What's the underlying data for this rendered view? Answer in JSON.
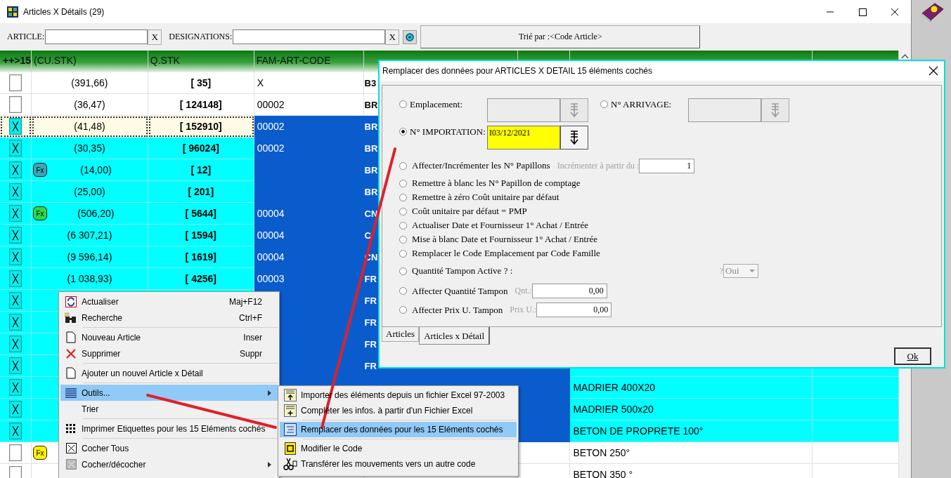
{
  "window": {
    "title": "Articles X Détails (29)"
  },
  "toolbar": {
    "article_label": "ARTICLE:",
    "article_clear": "X",
    "designation_label": "DESIGNATIONS:",
    "designation_clear": "X",
    "sort_button": "Trié par :<Code Article>"
  },
  "table": {
    "columns": [
      {
        "label": "++>15"
      },
      {
        "label": "(CU.STK)"
      },
      {
        "label": "Q.STK"
      },
      {
        "label": "FAM-ART-CODE"
      }
    ],
    "rows": [
      {
        "checked": false,
        "selected": false,
        "cu_stk": "(391,66)",
        "q_stk": "[ 35]",
        "fam_code": "X",
        "article": "B3"
      },
      {
        "checked": false,
        "selected": false,
        "cu_stk": "(36,47)",
        "q_stk": "[ 124148]",
        "fam_code": "00002",
        "article": "BR"
      },
      {
        "checked": true,
        "selected": true,
        "cu_stk": "(41,48)",
        "q_stk": "[ 152910]",
        "fam_code": "00002",
        "article": "BR"
      },
      {
        "checked": true,
        "selected": false,
        "cu_stk": "(30,35)",
        "q_stk": "[ 96024]",
        "fam_code": "00002",
        "article": "BR"
      },
      {
        "checked": true,
        "selected": false,
        "badge": "Fx",
        "color": "#3aa6b4",
        "cu_stk": "(14,00)",
        "q_stk": "[ 12]",
        "article": "BR"
      },
      {
        "checked": true,
        "selected": false,
        "cu_stk": "(25,00)",
        "q_stk": "[ 201]",
        "article": "BR"
      },
      {
        "checked": true,
        "selected": false,
        "badge": "Fx",
        "color": "#2ed84a",
        "cu_stk": "(506,20)",
        "q_stk": "[ 5644]",
        "fam_code": "00004",
        "article": "CN"
      },
      {
        "checked": true,
        "selected": false,
        "cu_stk": "(6 307,21)",
        "q_stk": "[ 1594]",
        "fam_code": "00004",
        "article": "C"
      },
      {
        "checked": true,
        "selected": false,
        "cu_stk": "(9 596,14)",
        "q_stk": "[ 1619]",
        "fam_code": "00004",
        "article": "CN"
      },
      {
        "checked": true,
        "selected": false,
        "cu_stk": "(1 038,93)",
        "q_stk": "[ 4256]",
        "fam_code": "00003",
        "article": "FR"
      },
      {
        "checked": true,
        "selected": false,
        "article": "FR"
      },
      {
        "checked": true,
        "selected": false,
        "article": "FR"
      },
      {
        "checked": true,
        "selected": false,
        "article": "FR"
      },
      {
        "checked": true,
        "selected": false,
        "article": "FR"
      },
      {
        "checked": true,
        "selected": false,
        "designation": "MADRIER 400X20"
      },
      {
        "checked": true,
        "selected": false,
        "designation": "MADRIER 500x20"
      },
      {
        "checked": true,
        "selected": false,
        "designation": "BETON DE PROPRETE 100°"
      },
      {
        "checked": false,
        "selected": false,
        "badge": "Fx",
        "color": "#fff200",
        "designation": "BETON 250°"
      },
      {
        "checked": false,
        "selected": false,
        "designation": "BETON 350 °"
      }
    ]
  },
  "context_menu": {
    "items": [
      {
        "kind": "item",
        "label": "Actualiser",
        "shortcut": "Maj+F12",
        "selected": false,
        "submenu": false
      },
      {
        "kind": "item",
        "label": "Recherche",
        "shortcut": "Ctrl+F",
        "selected": false,
        "submenu": false
      },
      {
        "kind": "separator"
      },
      {
        "kind": "item",
        "label": "Nouveau Article",
        "shortcut": "Inser",
        "selected": false,
        "submenu": false
      },
      {
        "kind": "item",
        "label": "Supprimer",
        "shortcut": "Suppr",
        "selected": false,
        "submenu": false
      },
      {
        "kind": "separator"
      },
      {
        "kind": "item",
        "label": "Ajouter un nouvel Article x Détail",
        "selected": false,
        "submenu": false
      },
      {
        "kind": "separator"
      },
      {
        "kind": "item",
        "label": "Outils...",
        "selected": true,
        "submenu": true
      },
      {
        "kind": "item",
        "label": "Trier",
        "selected": false,
        "submenu": false
      },
      {
        "kind": "separator"
      },
      {
        "kind": "item",
        "label": "Imprimer Etiquettes pour les 15 Eléments cochés",
        "selected": false,
        "submenu": false
      },
      {
        "kind": "separator"
      },
      {
        "kind": "item",
        "label": "Cocher Tous",
        "selected": false,
        "submenu": false
      },
      {
        "kind": "item",
        "label": "Cocher/décocher",
        "selected": false,
        "submenu": true
      }
    ]
  },
  "submenu": {
    "items": [
      {
        "kind": "item",
        "label": "Importer des éléments depuis un fichier Excel 97-2003",
        "selected": false
      },
      {
        "kind": "item",
        "label": "Compléter les infos. à partir d'un Fichier Excel",
        "selected": false
      },
      {
        "kind": "separator"
      },
      {
        "kind": "item",
        "label": "Remplacer des données pour les 15 Eléments cochés",
        "selected": true
      },
      {
        "kind": "separator"
      },
      {
        "kind": "item",
        "label": "Modifier le Code",
        "selected": false
      },
      {
        "kind": "item",
        "label": "Transférer les mouvements vers un autre code",
        "selected": false
      }
    ]
  },
  "dialog": {
    "title": "Remplacer des données pour ARTICLES X DETAIL 15 éléments cochés",
    "pickers": [
      {
        "label": "Emplacement:",
        "selected": false,
        "enabled": false
      },
      {
        "label": "N° ARRIVAGE:",
        "selected": false,
        "enabled": false
      },
      {
        "label": "N° IMPORTATION:",
        "selected": true,
        "enabled": true,
        "value": "I03/12/2021"
      }
    ],
    "options": [
      {
        "kind": "number",
        "label": "Affecter/Incrémenter les N° Papillons",
        "selected": false,
        "hint": "Incrémenter à partir du :",
        "value": "1"
      },
      {
        "kind": "plain",
        "label": "Remettre à blanc les N° Papillon de comptage",
        "selected": false
      },
      {
        "kind": "plain",
        "label": "Remettre à zéro Coût unitaire par défaut",
        "selected": false
      },
      {
        "kind": "plain",
        "label": "Coût unitaire par défaut =  PMP",
        "selected": false
      },
      {
        "kind": "plain",
        "label": "Actualiser Date et Fournisseur 1° Achat / Entrée",
        "selected": false
      },
      {
        "kind": "plain",
        "label": "Mise à blanc Date et Fournisseur 1° Achat / Entrée",
        "selected": false
      },
      {
        "kind": "plain",
        "label": "Remplacer le Code Emplacement par Code Famille",
        "selected": false
      },
      {
        "kind": "combo",
        "label": "Quantité Tampon Active ? :",
        "selected": false,
        "hint": "?",
        "value": "Oui"
      },
      {
        "kind": "amount",
        "label": "Affecter Quantité Tampon",
        "selected": false,
        "hint": "Qnt.:",
        "value": "0,00"
      },
      {
        "kind": "amount",
        "label": "Affecter Prix U. Tampon",
        "selected": false,
        "hint": "Prix U.:",
        "value": "0,00"
      }
    ],
    "tabs": [
      {
        "label": "Articles",
        "selected": false
      },
      {
        "label": "Articles x Détail",
        "selected": true
      }
    ],
    "ok_button": "Ok"
  }
}
